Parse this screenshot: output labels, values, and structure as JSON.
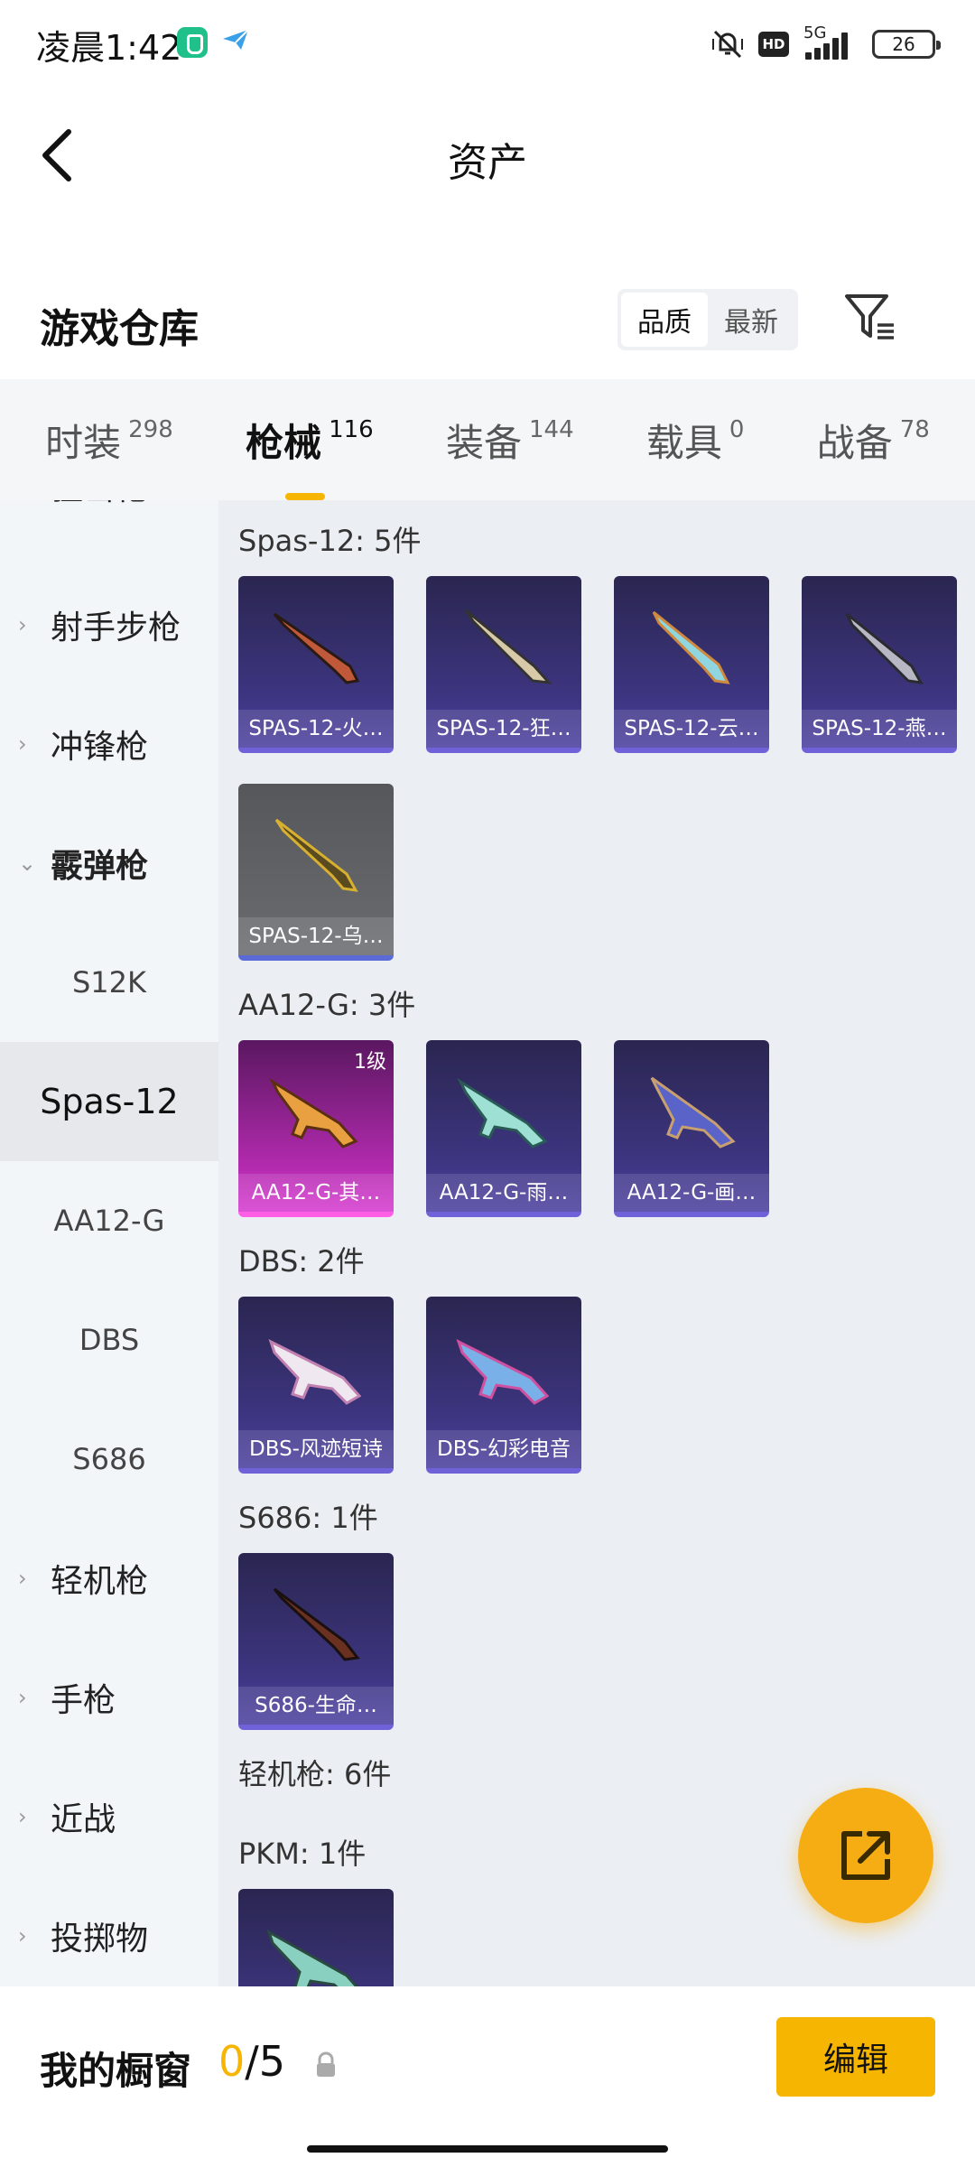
{
  "status_bar": {
    "time": "凌晨1:42",
    "hd": "HD",
    "network": "5G",
    "battery": "26"
  },
  "header": {
    "title": "资产"
  },
  "warehouse": {
    "title": "游戏仓库",
    "sort_options": [
      "品质",
      "最新"
    ],
    "active_sort": "品质"
  },
  "tabs": [
    {
      "label": "时装",
      "count": "298"
    },
    {
      "label": "枪械",
      "count": "116"
    },
    {
      "label": "装备",
      "count": "144"
    },
    {
      "label": "载具",
      "count": "0"
    },
    {
      "label": "战备",
      "count": "78"
    }
  ],
  "sidebar": {
    "partial_top": "狙击枪",
    "categories": [
      "射手步枪",
      "冲锋枪",
      "霰弹枪"
    ],
    "sub_items": [
      "S12K",
      "Spas-12",
      "AA12-G",
      "DBS",
      "S686"
    ],
    "active_sub": "Spas-12",
    "more_categories": [
      "轻机枪",
      "手枪",
      "近战",
      "投掷物"
    ]
  },
  "groups": [
    {
      "title": "Spas-12: 5件",
      "items": [
        "SPAS-12-火…",
        "SPAS-12-狂…",
        "SPAS-12-云…",
        "SPAS-12-燕…",
        "SPAS-12-乌…"
      ]
    },
    {
      "title": "AA12-G: 3件",
      "items": [
        "AA12-G-其…",
        "AA12-G-雨…",
        "AA12-G-画…"
      ],
      "badge": "1级"
    },
    {
      "title": "DBS: 2件",
      "items": [
        "DBS-风迹短诗",
        "DBS-幻彩电音"
      ]
    },
    {
      "title": "S686: 1件",
      "items": [
        "S686-生命…"
      ]
    },
    {
      "title": "轻机枪: 6件"
    },
    {
      "title": "PKM: 1件"
    }
  ],
  "showcase": {
    "title": "我的橱窗",
    "current": "0",
    "total": "/5",
    "edit_label": "编辑"
  },
  "colors": {
    "accent": "#f6b500",
    "card_purple": "#3d3580",
    "card_pink": "#b42bb0",
    "card_gray": "#6a6c70"
  }
}
